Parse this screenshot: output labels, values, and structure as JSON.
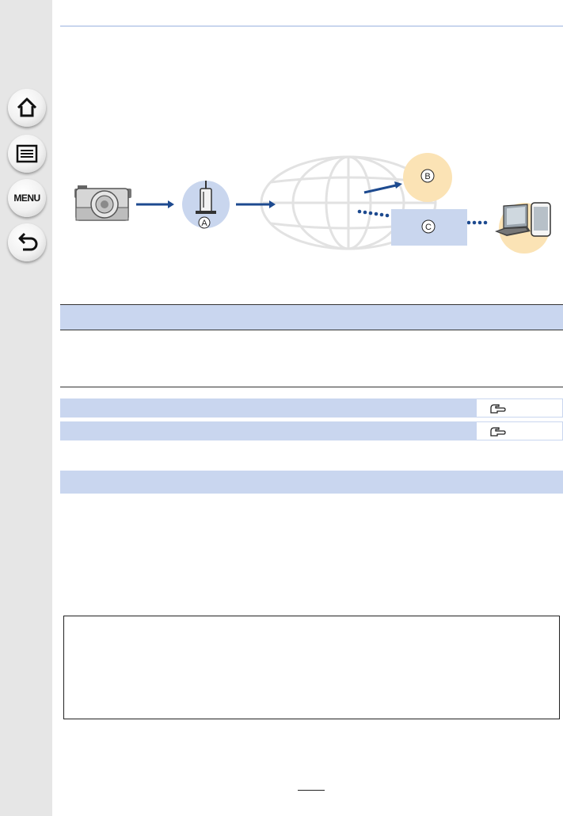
{
  "sidebar": {
    "buttons": [
      {
        "name": "home",
        "icon": "home-icon"
      },
      {
        "name": "contents",
        "icon": "list-icon"
      },
      {
        "name": "menu",
        "icon": "menu-icon",
        "label": "MENU"
      },
      {
        "name": "back",
        "icon": "back-arrow-icon"
      }
    ]
  },
  "diagram": {
    "label_a": "A",
    "label_b": "B",
    "label_c": "C",
    "icons": [
      "camera-icon",
      "wireless-access-point-icon",
      "globe-icon",
      "pc-icon",
      "smartphone-icon"
    ],
    "colors": {
      "arrow": "#1d4a8f",
      "access_point_bg": "#c9d6ee",
      "server_b": "#fbe3b5",
      "server_c": "#c9d6ee",
      "devices_bg": "#fbe3b5"
    }
  },
  "references": [
    {
      "icon": "page-reference-icon"
    },
    {
      "icon": "page-reference-icon"
    }
  ],
  "colors": {
    "band": "#c9d6ef",
    "sidebar": "#e6e6e6"
  }
}
